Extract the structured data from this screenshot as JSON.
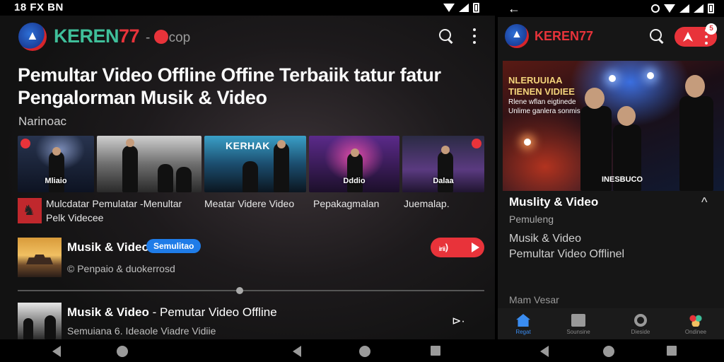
{
  "left": {
    "status_time": "18 FX BN",
    "brand_part1": "KEREN",
    "brand_part2": "77",
    "domain": "-",
    "domain_suffix": "cop",
    "title": "Pemultar Video Offline Offine Terbaiik tatur fatur Pengalorman Musik & Video",
    "section": "Narinoac",
    "thumbs": [
      {
        "caption": "Mliaio"
      },
      {
        "caption": ""
      },
      {
        "top_text": "KERHAK",
        "caption": ""
      },
      {
        "caption": "Dddio"
      },
      {
        "caption": "Dalaa"
      }
    ],
    "captions": [
      "Mulcdatar Pemulatar -Menultar Pelk Videcee",
      "Meatar Videre Video",
      "Pepakagmalan",
      "Juemalap."
    ],
    "row1": {
      "title": "Musik & Video",
      "badge": "Semulitao",
      "subtitle": "© Penpaio & duokerrosd",
      "play_label": "ᵢᵣᵢᵢ)"
    },
    "row2": {
      "title_bold": "Musik & Video",
      "title_rest": " - Pemutar Video Offline",
      "subtitle": "Semuiana 6. Ideaole Viadre Vidiie",
      "cast_glyph": "⊳·"
    }
  },
  "right": {
    "brand": "KEREN77",
    "notif": "5",
    "hero": {
      "title": "NLERUUIAA TIENEN VIDIEE",
      "lines": "Rlene wflan eigtinede\nUnlime ganlera sonmis",
      "caption": "INESBUCO"
    },
    "heading": "Muslity & Video",
    "chevron": "^",
    "subtitle": "Pemuleng",
    "line1": "Musik & Video",
    "line2": "Pemultar Video Offlinel",
    "line3": "Mam Vesar",
    "nav": [
      {
        "label": "Regat",
        "active": true
      },
      {
        "label": "Sounsine",
        "active": false
      },
      {
        "label": "Dieside",
        "active": false
      },
      {
        "label": "Ondinee",
        "active": false
      }
    ]
  }
}
